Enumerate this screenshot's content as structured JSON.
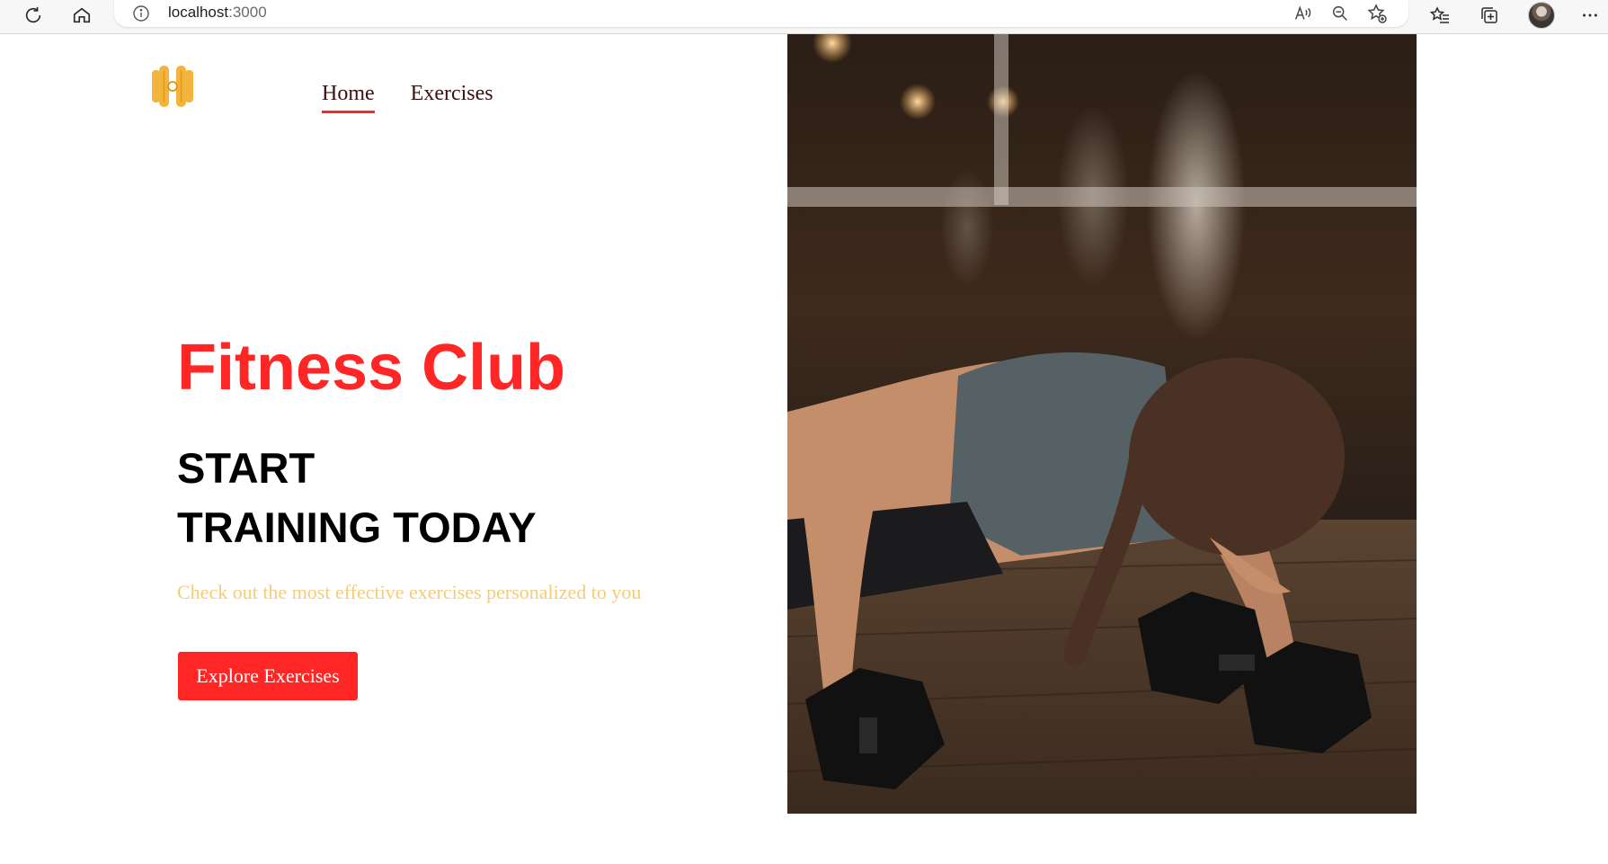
{
  "browser": {
    "url_host": "localhost",
    "url_port": ":3000",
    "icons": [
      "refresh-icon",
      "home-icon",
      "info-icon",
      "read-aloud-icon",
      "zoom-out-icon",
      "favorite-add-icon",
      "favorites-icon",
      "collections-icon",
      "profile-avatar",
      "more-icon"
    ]
  },
  "navbar": {
    "logo_icon": "dumbbell-logo-icon",
    "links": [
      {
        "label": "Home",
        "active": true
      },
      {
        "label": "Exercises",
        "active": false
      }
    ]
  },
  "hero": {
    "title": "Fitness Club",
    "heading_line1": "START",
    "heading_line2": "TRAINING TODAY",
    "subtitle": "Check out the most effective exercises personalized to you",
    "button_label": "Explore Exercises",
    "image": "woman-pushup-dumbbells-photo"
  },
  "colors": {
    "accent": "#ff2625",
    "subtitle": "#f5cc7a",
    "logo": "#f2b43a",
    "nav_text": "#3a1212"
  }
}
